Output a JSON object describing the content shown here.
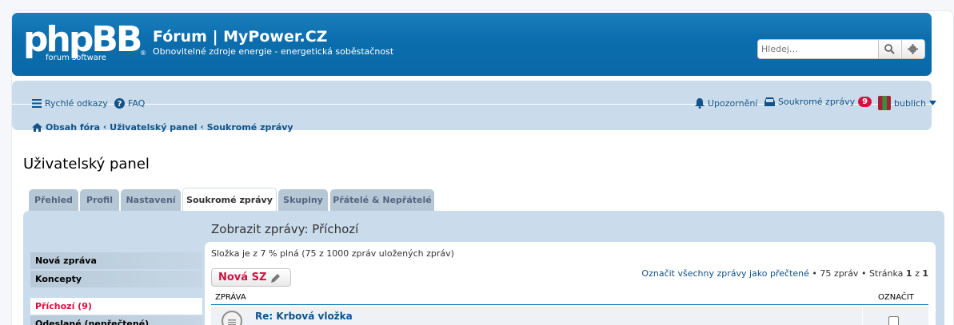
{
  "header": {
    "logo_text": "phpBB",
    "logo_sub": "forum software",
    "site_title": "Fórum | MyPower.CZ",
    "site_description": "Obnovitelné zdroje energie - energetická soběstačnost",
    "search_placeholder": "Hledej…"
  },
  "navbar": {
    "quick_links": "Rychlé odkazy",
    "faq": "FAQ",
    "notifications": "Upozornění",
    "private_messages": "Soukromé zprávy",
    "pm_count": "9",
    "username": "bublich",
    "breadcrumb": [
      "Obsah fóra",
      "Uživatelský panel",
      "Soukromé zprávy"
    ]
  },
  "page_title": "Uživatelský panel",
  "tabs": [
    "Přehled",
    "Profil",
    "Nastavení",
    "Soukromé zprávy",
    "Skupiny",
    "Přátelé & Nepřátelé"
  ],
  "sidebar": {
    "items": [
      "Nová zpráva",
      "Koncepty",
      "Příchozí (9)",
      "Odeslané (nepřečtené)"
    ]
  },
  "content": {
    "heading": "Zobrazit zprávy: Příchozí",
    "folder_status": "Složka je z 7 % plná (75 z 1000 zpráv uložených zpráv)",
    "new_button": "Nová SZ",
    "mark_all_read": "Označit všechny zprávy jako přečtené",
    "message_count": "75 zpráv",
    "page_label": "Stránka",
    "page_current": "1",
    "page_of": "z",
    "page_total": "1",
    "col_message": "ZPRÁVA",
    "col_mark": "OZNAČIT",
    "rows": [
      {
        "title": "Re: Krbová vložka"
      }
    ]
  },
  "colors": {
    "header_blue": "#0c6eae",
    "nav_bg": "#cadceb",
    "badge_red": "#d31141",
    "link_blue": "#105289"
  }
}
